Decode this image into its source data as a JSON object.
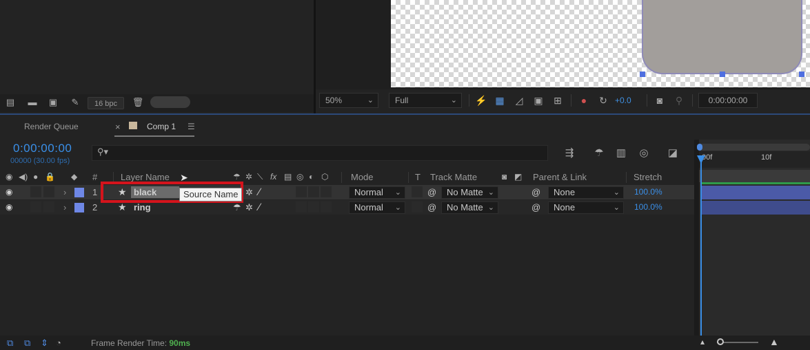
{
  "project_panel": {
    "bpc_label": "16 bpc",
    "icons": [
      "interpret-footage-icon",
      "folder-icon",
      "new-comp-icon",
      "flowchart-icon",
      "trash-icon"
    ]
  },
  "viewer": {
    "zoom": "50%",
    "resolution": "Full",
    "exposure": "+0.0",
    "timecode": "0:00:00:00"
  },
  "timeline": {
    "tabs": [
      {
        "label": "Render Queue"
      },
      {
        "label": "Comp 1",
        "close": "×",
        "menu": "☰"
      }
    ],
    "current_time": "0:00:00:00",
    "fps_info": "00000 (30.00 fps)",
    "columns": {
      "hash": "#",
      "layer_name": "Layer Name",
      "mode": "Mode",
      "t": "T",
      "track_matte": "Track Matte",
      "parent_link": "Parent & Link",
      "stretch": "Stretch"
    },
    "layers": [
      {
        "num": "1",
        "name": "black",
        "mode": "Normal",
        "track_matte": "No Matte",
        "parent": "None",
        "stretch": "100.0%"
      },
      {
        "num": "2",
        "name": "ring",
        "mode": "Normal",
        "track_matte": "No Matte",
        "parent": "None",
        "stretch": "100.0%"
      }
    ],
    "tooltip": "Source Name",
    "ruler": {
      "start": "00f",
      "mark": "10f"
    }
  },
  "status_bar": {
    "render_time_label": "Frame Render Time: ",
    "render_time_value": "90ms"
  },
  "colors": {
    "accent_blue": "#3a8fe8",
    "layer_label": "#6e87e6",
    "highlight_red": "#d4141c",
    "render_time_green": "#4fb04f"
  }
}
